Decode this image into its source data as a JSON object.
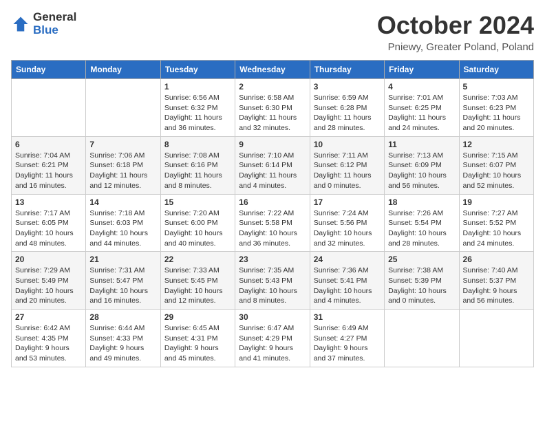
{
  "header": {
    "logo_general": "General",
    "logo_blue": "Blue",
    "month_title": "October 2024",
    "location": "Pniewy, Greater Poland, Poland"
  },
  "weekdays": [
    "Sunday",
    "Monday",
    "Tuesday",
    "Wednesday",
    "Thursday",
    "Friday",
    "Saturday"
  ],
  "weeks": [
    [
      {
        "day": "",
        "detail": ""
      },
      {
        "day": "",
        "detail": ""
      },
      {
        "day": "1",
        "detail": "Sunrise: 6:56 AM\nSunset: 6:32 PM\nDaylight: 11 hours and 36 minutes."
      },
      {
        "day": "2",
        "detail": "Sunrise: 6:58 AM\nSunset: 6:30 PM\nDaylight: 11 hours and 32 minutes."
      },
      {
        "day": "3",
        "detail": "Sunrise: 6:59 AM\nSunset: 6:28 PM\nDaylight: 11 hours and 28 minutes."
      },
      {
        "day": "4",
        "detail": "Sunrise: 7:01 AM\nSunset: 6:25 PM\nDaylight: 11 hours and 24 minutes."
      },
      {
        "day": "5",
        "detail": "Sunrise: 7:03 AM\nSunset: 6:23 PM\nDaylight: 11 hours and 20 minutes."
      }
    ],
    [
      {
        "day": "6",
        "detail": "Sunrise: 7:04 AM\nSunset: 6:21 PM\nDaylight: 11 hours and 16 minutes."
      },
      {
        "day": "7",
        "detail": "Sunrise: 7:06 AM\nSunset: 6:18 PM\nDaylight: 11 hours and 12 minutes."
      },
      {
        "day": "8",
        "detail": "Sunrise: 7:08 AM\nSunset: 6:16 PM\nDaylight: 11 hours and 8 minutes."
      },
      {
        "day": "9",
        "detail": "Sunrise: 7:10 AM\nSunset: 6:14 PM\nDaylight: 11 hours and 4 minutes."
      },
      {
        "day": "10",
        "detail": "Sunrise: 7:11 AM\nSunset: 6:12 PM\nDaylight: 11 hours and 0 minutes."
      },
      {
        "day": "11",
        "detail": "Sunrise: 7:13 AM\nSunset: 6:09 PM\nDaylight: 10 hours and 56 minutes."
      },
      {
        "day": "12",
        "detail": "Sunrise: 7:15 AM\nSunset: 6:07 PM\nDaylight: 10 hours and 52 minutes."
      }
    ],
    [
      {
        "day": "13",
        "detail": "Sunrise: 7:17 AM\nSunset: 6:05 PM\nDaylight: 10 hours and 48 minutes."
      },
      {
        "day": "14",
        "detail": "Sunrise: 7:18 AM\nSunset: 6:03 PM\nDaylight: 10 hours and 44 minutes."
      },
      {
        "day": "15",
        "detail": "Sunrise: 7:20 AM\nSunset: 6:00 PM\nDaylight: 10 hours and 40 minutes."
      },
      {
        "day": "16",
        "detail": "Sunrise: 7:22 AM\nSunset: 5:58 PM\nDaylight: 10 hours and 36 minutes."
      },
      {
        "day": "17",
        "detail": "Sunrise: 7:24 AM\nSunset: 5:56 PM\nDaylight: 10 hours and 32 minutes."
      },
      {
        "day": "18",
        "detail": "Sunrise: 7:26 AM\nSunset: 5:54 PM\nDaylight: 10 hours and 28 minutes."
      },
      {
        "day": "19",
        "detail": "Sunrise: 7:27 AM\nSunset: 5:52 PM\nDaylight: 10 hours and 24 minutes."
      }
    ],
    [
      {
        "day": "20",
        "detail": "Sunrise: 7:29 AM\nSunset: 5:49 PM\nDaylight: 10 hours and 20 minutes."
      },
      {
        "day": "21",
        "detail": "Sunrise: 7:31 AM\nSunset: 5:47 PM\nDaylight: 10 hours and 16 minutes."
      },
      {
        "day": "22",
        "detail": "Sunrise: 7:33 AM\nSunset: 5:45 PM\nDaylight: 10 hours and 12 minutes."
      },
      {
        "day": "23",
        "detail": "Sunrise: 7:35 AM\nSunset: 5:43 PM\nDaylight: 10 hours and 8 minutes."
      },
      {
        "day": "24",
        "detail": "Sunrise: 7:36 AM\nSunset: 5:41 PM\nDaylight: 10 hours and 4 minutes."
      },
      {
        "day": "25",
        "detail": "Sunrise: 7:38 AM\nSunset: 5:39 PM\nDaylight: 10 hours and 0 minutes."
      },
      {
        "day": "26",
        "detail": "Sunrise: 7:40 AM\nSunset: 5:37 PM\nDaylight: 9 hours and 56 minutes."
      }
    ],
    [
      {
        "day": "27",
        "detail": "Sunrise: 6:42 AM\nSunset: 4:35 PM\nDaylight: 9 hours and 53 minutes."
      },
      {
        "day": "28",
        "detail": "Sunrise: 6:44 AM\nSunset: 4:33 PM\nDaylight: 9 hours and 49 minutes."
      },
      {
        "day": "29",
        "detail": "Sunrise: 6:45 AM\nSunset: 4:31 PM\nDaylight: 9 hours and 45 minutes."
      },
      {
        "day": "30",
        "detail": "Sunrise: 6:47 AM\nSunset: 4:29 PM\nDaylight: 9 hours and 41 minutes."
      },
      {
        "day": "31",
        "detail": "Sunrise: 6:49 AM\nSunset: 4:27 PM\nDaylight: 9 hours and 37 minutes."
      },
      {
        "day": "",
        "detail": ""
      },
      {
        "day": "",
        "detail": ""
      }
    ]
  ]
}
